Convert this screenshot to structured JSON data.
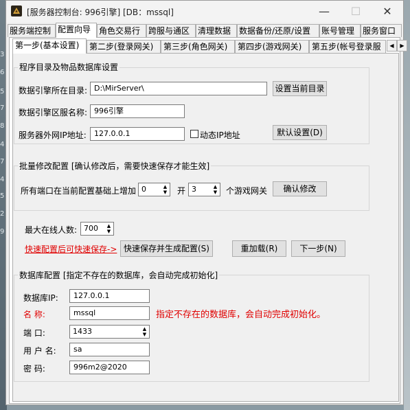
{
  "window": {
    "title": "[服务器控制台: 996引擎] [DB：mssql]",
    "controls": {
      "minimize": "—",
      "maximize": "☐",
      "close": "✕"
    }
  },
  "background_strip": [
    "3",
    "6",
    "5",
    "7",
    "8",
    "4",
    "7",
    "4",
    "5",
    "2",
    "9"
  ],
  "main_tabs": [
    "服务端控制",
    "配置向导",
    "角色交易行",
    "跨服与通区",
    "清理数据",
    "数据备份/还原/设置",
    "账号管理",
    "服务窗口"
  ],
  "sub_tabs": [
    "第一步(基本设置)",
    "第二步(登录网关)",
    "第三步(角色网关)",
    "第四步(游戏网关)",
    "第五步(帐号登录服"
  ],
  "tab_scroll": {
    "left": "◀",
    "right": "▶"
  },
  "program_group": {
    "title": "程序目录及物品数据库设置",
    "engine_dir_label": "数据引擎所在目录:",
    "engine_dir_value": "D:\\MirServer\\",
    "set_current_dir_button": "设置当前目录",
    "server_name_label": "数据引擎区服名称:",
    "server_name_value": "996引擎",
    "external_ip_label": "服务器外网IP地址:",
    "external_ip_value": "127.0.0.1",
    "dynamic_ip_label": "动态IP地址",
    "default_settings_button": "默认设置(D)"
  },
  "batch_group": {
    "title": "批量修改配置 [确认修改后，需要快速保存才能生效]",
    "port_increase_label": "所有端口在当前配置基础上增加",
    "port_increase_value": "0",
    "open_label": "开",
    "gateway_count_value": "3",
    "gateway_suffix_label": "个游戏网关",
    "confirm_button": "确认修改"
  },
  "online": {
    "max_label": "最大在线人数:",
    "max_value": "700"
  },
  "actions": {
    "hint_link": "快速配置后可快速保存->",
    "save_generate_button": "快速保存并生成配置(S)",
    "reload_button": "重加载(R)",
    "next_button": "下一步(N)"
  },
  "db_group": {
    "title": "数据库配置 [指定不存在的数据库，会自动完成初始化]",
    "ip_label": "数据库IP:",
    "ip_value": "127.0.0.1",
    "name_label": "名    称:",
    "name_value": "mssql",
    "name_hint": "指定不存在的数据库，会自动完成初始化。",
    "port_label": "端    口:",
    "port_value": "1433",
    "user_label": "用 户 名:",
    "user_value": "sa",
    "password_label": "密    码:",
    "password_value": "996m2@2020"
  },
  "colors": {
    "hint_red": "#e00000",
    "window_bg": "#f0f0f0"
  }
}
